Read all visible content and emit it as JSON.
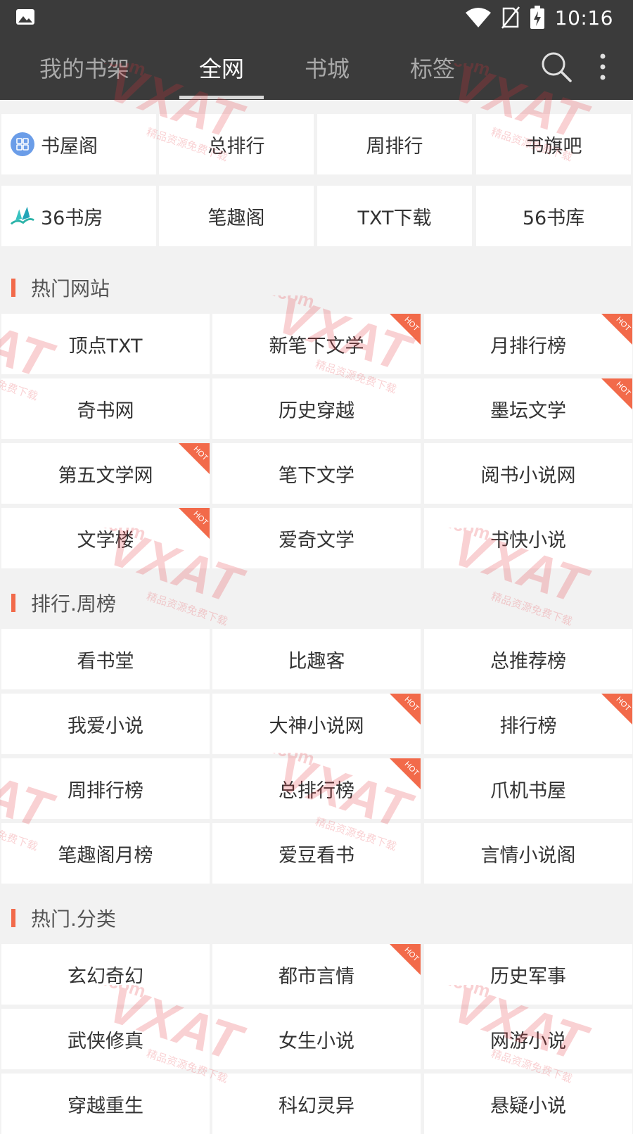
{
  "status": {
    "time": "10:16"
  },
  "tabs": [
    {
      "label": "我的书架",
      "active": false
    },
    {
      "label": "全网",
      "active": true
    },
    {
      "label": "书城",
      "active": false
    },
    {
      "label": "标签",
      "active": false
    }
  ],
  "quick": [
    {
      "label": "书屋阁",
      "icon": "grid-icon"
    },
    {
      "label": "总排行"
    },
    {
      "label": "周排行"
    },
    {
      "label": "书旗吧"
    },
    {
      "label": "36书房",
      "icon": "book-logo-icon"
    },
    {
      "label": "笔趣阁"
    },
    {
      "label": "TXT下载"
    },
    {
      "label": "56书库"
    }
  ],
  "hot_badge": "HOT",
  "sections": [
    {
      "title": "热门网站",
      "items": [
        {
          "label": "顶点TXT",
          "hot": false
        },
        {
          "label": "新笔下文学",
          "hot": true
        },
        {
          "label": "月排行榜",
          "hot": true
        },
        {
          "label": "奇书网",
          "hot": false
        },
        {
          "label": "历史穿越",
          "hot": false
        },
        {
          "label": "墨坛文学",
          "hot": true
        },
        {
          "label": "第五文学网",
          "hot": true
        },
        {
          "label": "笔下文学",
          "hot": false
        },
        {
          "label": "阅书小说网",
          "hot": false
        },
        {
          "label": "文学楼",
          "hot": true
        },
        {
          "label": "爱奇文学",
          "hot": false
        },
        {
          "label": "书快小说",
          "hot": false
        }
      ]
    },
    {
      "title": "排行.周榜",
      "items": [
        {
          "label": "看书堂",
          "hot": false
        },
        {
          "label": "比趣客",
          "hot": false
        },
        {
          "label": "总推荐榜",
          "hot": false
        },
        {
          "label": "我爱小说",
          "hot": false
        },
        {
          "label": "大神小说网",
          "hot": true
        },
        {
          "label": "排行榜",
          "hot": true
        },
        {
          "label": "周排行榜",
          "hot": false
        },
        {
          "label": "总排行榜",
          "hot": true
        },
        {
          "label": "爪机书屋",
          "hot": false
        },
        {
          "label": "笔趣阁月榜",
          "hot": false
        },
        {
          "label": "爱豆看书",
          "hot": false
        },
        {
          "label": "言情小说阁",
          "hot": false
        }
      ]
    },
    {
      "title": "热门.分类",
      "items": [
        {
          "label": "玄幻奇幻",
          "hot": false
        },
        {
          "label": "都市言情",
          "hot": true
        },
        {
          "label": "历史军事",
          "hot": false
        },
        {
          "label": "武侠修真",
          "hot": false
        },
        {
          "label": "女生小说",
          "hot": false
        },
        {
          "label": "网游小说",
          "hot": false
        },
        {
          "label": "穿越重生",
          "hot": false
        },
        {
          "label": "科幻灵异",
          "hot": false
        },
        {
          "label": "悬疑小说",
          "hot": false
        }
      ]
    }
  ],
  "watermark": {
    "text": "VXAT",
    "sub": ".com",
    "tag": "精品资源免费下载"
  },
  "colors": {
    "header": "#3b3b3b",
    "accent": "#f26a4a",
    "background": "#f2f2f2"
  }
}
